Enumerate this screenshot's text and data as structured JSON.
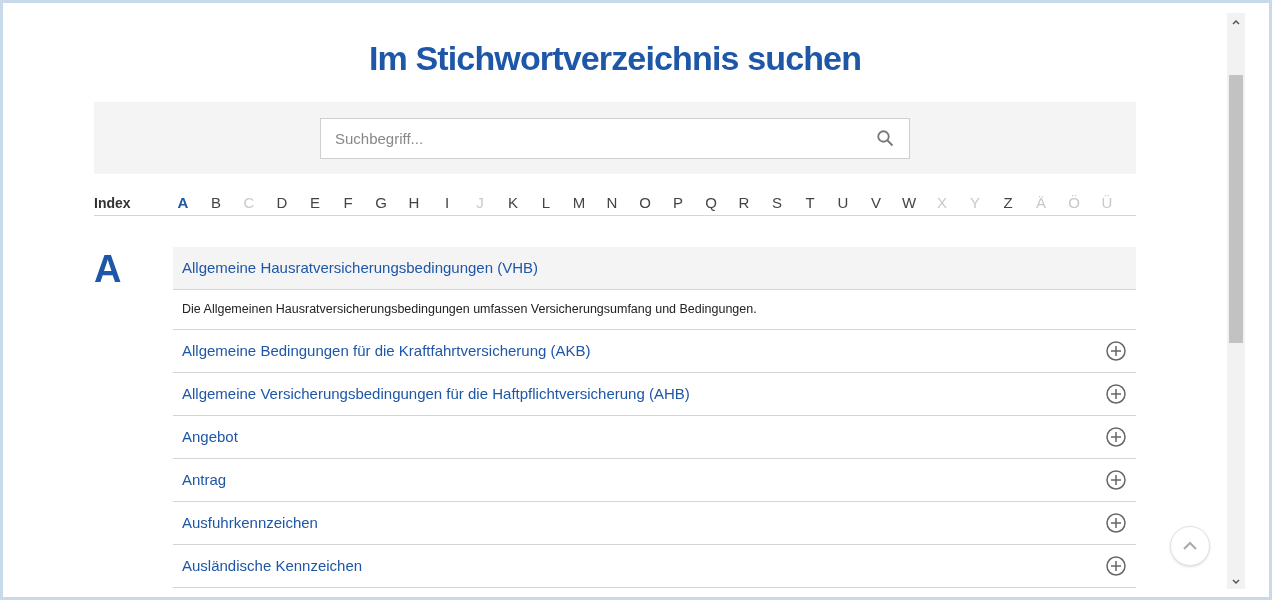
{
  "title": "Im Stichwortverzeichnis suchen",
  "search": {
    "placeholder": "Suchbegriff..."
  },
  "index": {
    "label": "Index",
    "letters": [
      {
        "letter": "A",
        "selected": true,
        "disabled": false
      },
      {
        "letter": "B",
        "selected": false,
        "disabled": false
      },
      {
        "letter": "C",
        "selected": false,
        "disabled": true
      },
      {
        "letter": "D",
        "selected": false,
        "disabled": false
      },
      {
        "letter": "E",
        "selected": false,
        "disabled": false
      },
      {
        "letter": "F",
        "selected": false,
        "disabled": false
      },
      {
        "letter": "G",
        "selected": false,
        "disabled": false
      },
      {
        "letter": "H",
        "selected": false,
        "disabled": false
      },
      {
        "letter": "I",
        "selected": false,
        "disabled": false
      },
      {
        "letter": "J",
        "selected": false,
        "disabled": true
      },
      {
        "letter": "K",
        "selected": false,
        "disabled": false
      },
      {
        "letter": "L",
        "selected": false,
        "disabled": false
      },
      {
        "letter": "M",
        "selected": false,
        "disabled": false
      },
      {
        "letter": "N",
        "selected": false,
        "disabled": false
      },
      {
        "letter": "O",
        "selected": false,
        "disabled": false
      },
      {
        "letter": "P",
        "selected": false,
        "disabled": false
      },
      {
        "letter": "Q",
        "selected": false,
        "disabled": false
      },
      {
        "letter": "R",
        "selected": false,
        "disabled": false
      },
      {
        "letter": "S",
        "selected": false,
        "disabled": false
      },
      {
        "letter": "T",
        "selected": false,
        "disabled": false
      },
      {
        "letter": "U",
        "selected": false,
        "disabled": false
      },
      {
        "letter": "V",
        "selected": false,
        "disabled": false
      },
      {
        "letter": "W",
        "selected": false,
        "disabled": false
      },
      {
        "letter": "X",
        "selected": false,
        "disabled": true
      },
      {
        "letter": "Y",
        "selected": false,
        "disabled": true
      },
      {
        "letter": "Z",
        "selected": false,
        "disabled": false
      },
      {
        "letter": "Ä",
        "selected": false,
        "disabled": true
      },
      {
        "letter": "Ö",
        "selected": false,
        "disabled": true
      },
      {
        "letter": "Ü",
        "selected": false,
        "disabled": true
      }
    ]
  },
  "section": {
    "letter": "A",
    "entries": [
      {
        "title": "Allgemeine Hausratversicherungsbedingungen (VHB)",
        "expanded": true,
        "description": "Die Allgemeinen Hausratversicherungsbedingungen umfassen Versicherungsumfang und Bedingungen."
      },
      {
        "title": "Allgemeine Bedingungen für die Kraftfahrtversicherung (AKB)",
        "expanded": false
      },
      {
        "title": "Allgemeine Versicherungsbedingungen für die Haftpflichtversicherung (AHB)",
        "expanded": false
      },
      {
        "title": "Angebot",
        "expanded": false
      },
      {
        "title": "Antrag",
        "expanded": false
      },
      {
        "title": "Ausfuhrkennzeichen",
        "expanded": false
      },
      {
        "title": "Ausländische Kennzeichen",
        "expanded": false
      }
    ]
  }
}
